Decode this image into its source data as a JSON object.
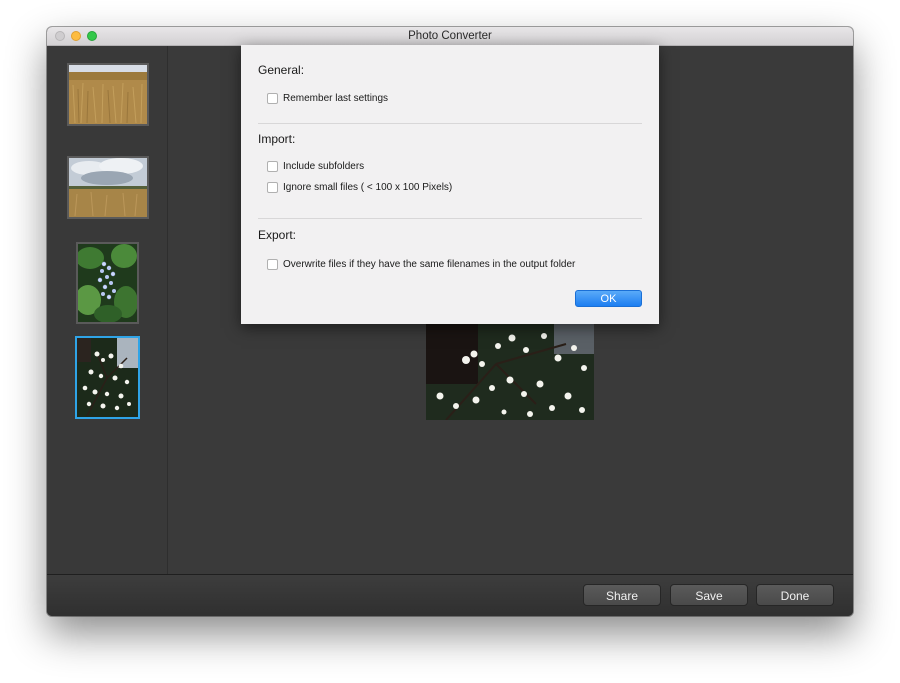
{
  "window": {
    "title": "Photo Converter"
  },
  "sidebar": {
    "thumbnails": [
      {
        "name": "wheat-field",
        "selected": false
      },
      {
        "name": "field-cloudy-sky",
        "selected": false
      },
      {
        "name": "blue-flowers",
        "selected": false
      },
      {
        "name": "white-blossoms",
        "selected": true
      }
    ]
  },
  "dialog": {
    "general": {
      "title": "General:",
      "options": [
        {
          "label": "Remember last settings",
          "checked": false
        }
      ]
    },
    "import": {
      "title": "Import:",
      "options": [
        {
          "label": "Include subfolders",
          "checked": false
        },
        {
          "label": "Ignore small files ( < 100 x 100 Pixels)",
          "checked": false
        }
      ]
    },
    "export": {
      "title": "Export:",
      "options": [
        {
          "label": "Overwrite files if they have the same filenames in the output folder",
          "checked": false
        }
      ]
    },
    "ok_label": "OK"
  },
  "toolbar": {
    "share_label": "Share",
    "save_label": "Save",
    "done_label": "Done"
  },
  "colors": {
    "accent": "#2fa4e7",
    "ok_button": "#1d7ef1",
    "window_bg": "#3a3a3a"
  }
}
